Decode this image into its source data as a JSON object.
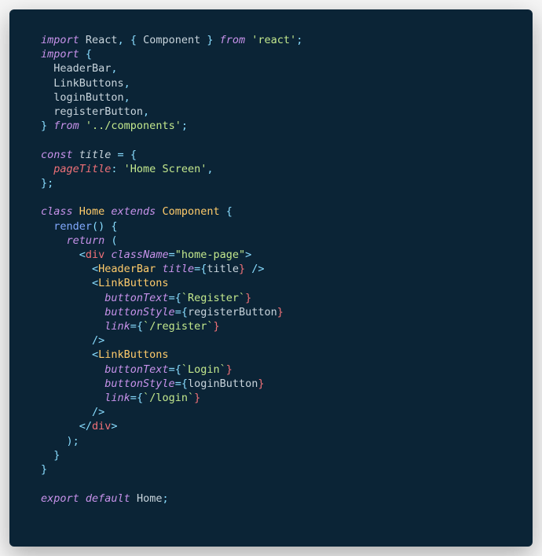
{
  "code": {
    "t00a": "import",
    "t00b": " React",
    "t00c": ",",
    "t00d": " {",
    "t00e": " Component ",
    "t00f": "}",
    "t00g": " from",
    "t00h": " 'react'",
    "t00i": ";",
    "t01a": "import",
    "t01b": " {",
    "t02a": "  HeaderBar",
    "t02b": ",",
    "t03a": "  LinkButtons",
    "t03b": ",",
    "t04a": "  loginButton",
    "t04b": ",",
    "t05a": "  registerButton",
    "t05b": ",",
    "t06a": "}",
    "t06b": " from",
    "t06c": " '../components'",
    "t06d": ";",
    "t07": "",
    "t08a": "const",
    "t08b": " title",
    "t08c": " =",
    "t08d": " {",
    "t09a": "  pageTitle",
    "t09b": ":",
    "t09c": " 'Home Screen'",
    "t09d": ",",
    "t10a": "}",
    "t10b": ";",
    "t11": "",
    "t12a": "class",
    "t12b": " Home",
    "t12c": " extends",
    "t12d": " Component",
    "t12e": " {",
    "t13a": "  render",
    "t13b": "()",
    "t13c": " {",
    "t14a": "    return",
    "t14b": " (",
    "t15a": "      <",
    "t15b": "div",
    "t15c": " className",
    "t15d": "=",
    "t15e": "\"home-page\"",
    "t15f": ">",
    "t16a": "        <",
    "t16b": "HeaderBar",
    "t16c": " title",
    "t16d": "=",
    "t16e": "{",
    "t16f": "title",
    "t16g": "}",
    "t16h": " />",
    "t17a": "        <",
    "t17b": "LinkButtons",
    "t18a": "          buttonText",
    "t18b": "=",
    "t18c": "{",
    "t18d": "`Register`",
    "t18e": "}",
    "t19a": "          buttonStyle",
    "t19b": "=",
    "t19c": "{",
    "t19d": "registerButton",
    "t19e": "}",
    "t20a": "          link",
    "t20b": "=",
    "t20c": "{",
    "t20d": "`/register`",
    "t20e": "}",
    "t21a": "        />",
    "t22a": "        <",
    "t22b": "LinkButtons",
    "t23a": "          buttonText",
    "t23b": "=",
    "t23c": "{",
    "t23d": "`Login`",
    "t23e": "}",
    "t24a": "          buttonStyle",
    "t24b": "=",
    "t24c": "{",
    "t24d": "loginButton",
    "t24e": "}",
    "t25a": "          link",
    "t25b": "=",
    "t25c": "{",
    "t25d": "`/login`",
    "t25e": "}",
    "t26a": "        />",
    "t27a": "      </",
    "t27b": "div",
    "t27c": ">",
    "t28a": "    )",
    "t28b": ";",
    "t29a": "  }",
    "t30a": "}",
    "t31": "",
    "t32a": "export",
    "t32b": " default",
    "t32c": " Home",
    "t32d": ";"
  }
}
